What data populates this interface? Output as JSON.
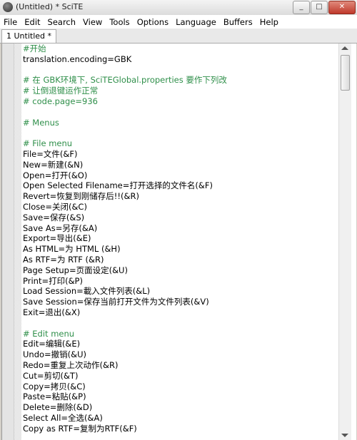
{
  "window": {
    "title": "(Untitled) * SciTE",
    "buttons": {
      "minimize": "_",
      "maximize": "□",
      "close": "✕"
    }
  },
  "menu": [
    "File",
    "Edit",
    "Search",
    "View",
    "Tools",
    "Options",
    "Language",
    "Buffers",
    "Help"
  ],
  "tabs": [
    {
      "label": "1 Untitled *"
    }
  ],
  "editor": {
    "lines": [
      {
        "text": "#开始",
        "comment": true
      },
      {
        "text": "translation.encoding=GBK",
        "comment": false
      },
      {
        "text": "",
        "comment": false
      },
      {
        "text": "# 在 GBK环境下, SciTEGlobal.properties 要作下列改",
        "comment": true
      },
      {
        "text": "# 让倒退键运作正常",
        "comment": true
      },
      {
        "text": "# code.page=936",
        "comment": true
      },
      {
        "text": "",
        "comment": false
      },
      {
        "text": "# Menus",
        "comment": true
      },
      {
        "text": "",
        "comment": false
      },
      {
        "text": "# File menu",
        "comment": true
      },
      {
        "text": "File=文件(&F)",
        "comment": false
      },
      {
        "text": "New=新建(&N)",
        "comment": false
      },
      {
        "text": "Open=打开(&O)",
        "comment": false
      },
      {
        "text": "Open Selected Filename=打开选择的文件名(&F)",
        "comment": false
      },
      {
        "text": "Revert=恢复到刚储存后!!(&R)",
        "comment": false
      },
      {
        "text": "Close=关闭(&C)",
        "comment": false
      },
      {
        "text": "Save=保存(&S)",
        "comment": false
      },
      {
        "text": "Save As=另存(&A)",
        "comment": false
      },
      {
        "text": "Export=导出(&E)",
        "comment": false
      },
      {
        "text": "As HTML=为 HTML (&H)",
        "comment": false
      },
      {
        "text": "As RTF=为 RTF (&R)",
        "comment": false
      },
      {
        "text": "Page Setup=页面设定(&U)",
        "comment": false
      },
      {
        "text": "Print=打印(&P)",
        "comment": false
      },
      {
        "text": "Load Session=載入文件列表(&L)",
        "comment": false
      },
      {
        "text": "Save Session=保存当前打开文件为文件列表(&V)",
        "comment": false
      },
      {
        "text": "Exit=退出(&X)",
        "comment": false
      },
      {
        "text": "",
        "comment": false
      },
      {
        "text": "# Edit menu",
        "comment": true
      },
      {
        "text": "Edit=编辑(&E)",
        "comment": false
      },
      {
        "text": "Undo=撤销(&U)",
        "comment": false
      },
      {
        "text": "Redo=重复上次动作(&R)",
        "comment": false
      },
      {
        "text": "Cut=剪切(&T)",
        "comment": false
      },
      {
        "text": "Copy=拷贝(&C)",
        "comment": false
      },
      {
        "text": "Paste=粘贴(&P)",
        "comment": false
      },
      {
        "text": "Delete=删除(&D)",
        "comment": false
      },
      {
        "text": "Select All=全选(&A)",
        "comment": false
      },
      {
        "text": "Copy as RTF=复制为RTF(&F)",
        "comment": false
      }
    ]
  },
  "colors": {
    "comment": "#2f8f4a",
    "text": "#000000",
    "background": "#ffffff"
  }
}
